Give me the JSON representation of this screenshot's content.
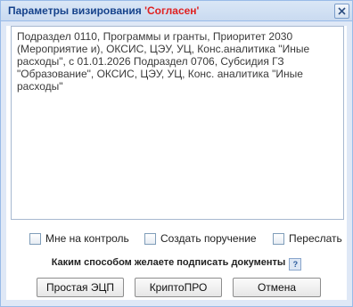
{
  "window": {
    "title_prefix": "Параметры визирования ",
    "title_status": "'Согласен'",
    "status_color": "#e02020",
    "close_icon": "close-icon"
  },
  "comment": {
    "text": "Подраздел 0110, Программы и гранты, Приоритет 2030 (Мероприятие и), ОКСИС, ЦЭУ, УЦ, Конс.аналитика \"Иные расходы\", с 01.01.2026 Подраздел 0706, Субсидия ГЗ \"Образование\", ОКСИС, ЦЭУ, УЦ, Конс. аналитика \"Иные расходы\""
  },
  "options": [
    {
      "label": "Мне на контроль",
      "checked": false
    },
    {
      "label": "Создать поручение",
      "checked": false
    },
    {
      "label": "Переслать",
      "checked": false
    }
  ],
  "question": {
    "text": "Каким способом желаете подписать документы",
    "help_icon": "?"
  },
  "buttons": {
    "simple_sign": "Простая ЭЦП",
    "cryptopro": "КриптоПРО",
    "cancel": "Отмена"
  }
}
